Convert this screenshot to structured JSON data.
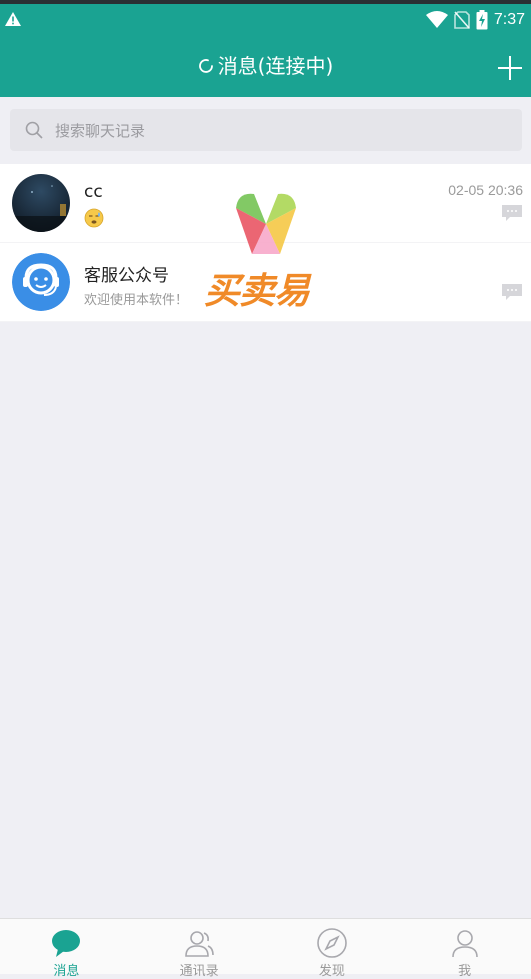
{
  "status_bar": {
    "time": "7:37",
    "icons": [
      "warning-icon",
      "wifi-icon",
      "no-sim-icon",
      "battery-charging-icon"
    ]
  },
  "header": {
    "title": "消息(连接中)",
    "loading_icon": "loading-icon",
    "add_icon": "plus-icon"
  },
  "search": {
    "placeholder": "搜索聊天记录",
    "icon": "search-icon"
  },
  "conversations": [
    {
      "name": "cc",
      "message_icon": "sleepy-emoji-icon",
      "time": "02-05 20:36",
      "avatar": "night-photo-avatar"
    },
    {
      "name": "客服公众号",
      "message": "欢迎使用本软件！",
      "time": "",
      "avatar": "customer-service-avatar"
    }
  ],
  "watermark": {
    "text": "买卖易"
  },
  "bottom_nav": [
    {
      "label": "消息",
      "icon": "chat-bubble-icon",
      "active": true
    },
    {
      "label": "通讯录",
      "icon": "contacts-icon",
      "active": false
    },
    {
      "label": "发现",
      "icon": "compass-icon",
      "active": false
    },
    {
      "label": "我",
      "icon": "person-icon",
      "active": false
    }
  ],
  "colors": {
    "primary": "#1aa392",
    "background": "#efeff4",
    "watermark_orange": "#f08a28"
  }
}
